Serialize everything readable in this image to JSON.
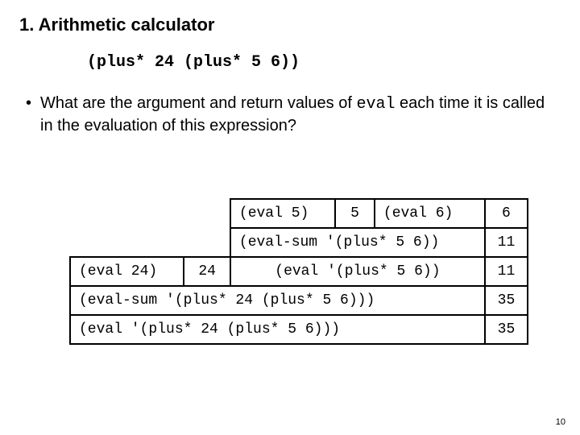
{
  "title": "1. Arithmetic calculator",
  "expression": "(plus* 24 (plus* 5 6))",
  "bullet": {
    "pre": "What are the argument and return values of ",
    "mono": "eval",
    "post": " each time it is called in the evaluation of this expression?"
  },
  "table": {
    "r1": {
      "c1": "(eval 5)",
      "c2": "5",
      "c3": "(eval 6)",
      "c4": "6"
    },
    "r2": {
      "c1": "(eval-sum '(plus* 5 6))",
      "c2": "11"
    },
    "r3": {
      "c1": "(eval 24)",
      "c2": "24",
      "c3": "(eval '(plus* 5 6))",
      "c4": "11"
    },
    "r4": {
      "c1": "(eval-sum '(plus* 24 (plus* 5 6)))",
      "c2": "35"
    },
    "r5": {
      "c1": "(eval '(plus* 24 (plus* 5 6)))",
      "c2": "35"
    }
  },
  "pageno": "10"
}
